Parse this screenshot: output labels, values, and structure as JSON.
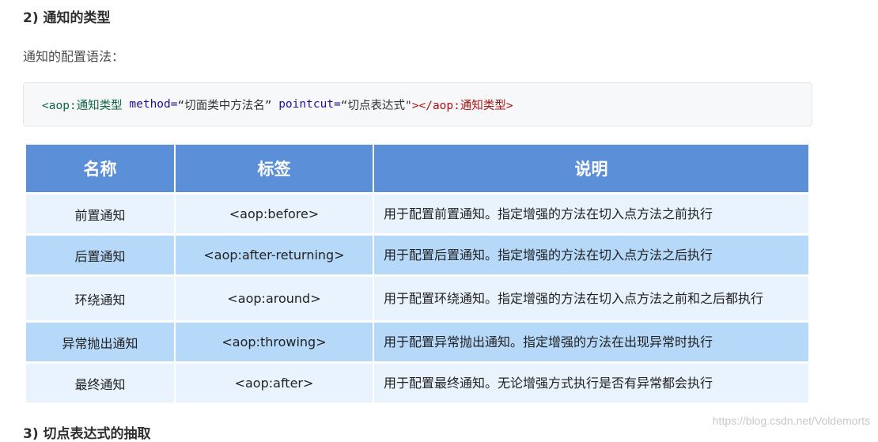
{
  "heading_2": "2) 通知的类型",
  "intro": "通知的配置语法：",
  "code": {
    "open_tag": "<aop:通知类型",
    "attr1_name": " method=",
    "attr1_value": "“切面类中方法名”",
    "attr2_name": " pointcut=",
    "attr2_value": "“切点表达式\"",
    "close_tag": "></aop:通知类型>"
  },
  "table": {
    "headers": [
      "名称",
      "标签",
      "说明"
    ],
    "rows": [
      {
        "name": "前置通知",
        "tag": "<aop:before>",
        "desc": "用于配置前置通知。指定增强的方法在切入点方法之前执行"
      },
      {
        "name": "后置通知",
        "tag": "<aop:after-returning>",
        "desc": "用于配置后置通知。指定增强的方法在切入点方法之后执行"
      },
      {
        "name": "环绕通知",
        "tag": "<aop:around>",
        "desc": "用于配置环绕通知。指定增强的方法在切入点方法之前和之后都执行"
      },
      {
        "name": "异常抛出通知",
        "tag": "<aop:throwing>",
        "desc": "用于配置异常抛出通知。指定增强的方法在出现异常时执行"
      },
      {
        "name": "最终通知",
        "tag": "<aop:after>",
        "desc": "用于配置最终通知。无论增强方式执行是否有异常都会执行"
      }
    ]
  },
  "heading_3": "3) 切点表达式的抽取",
  "watermark": "https://blog.csdn.net/Voldemorts"
}
